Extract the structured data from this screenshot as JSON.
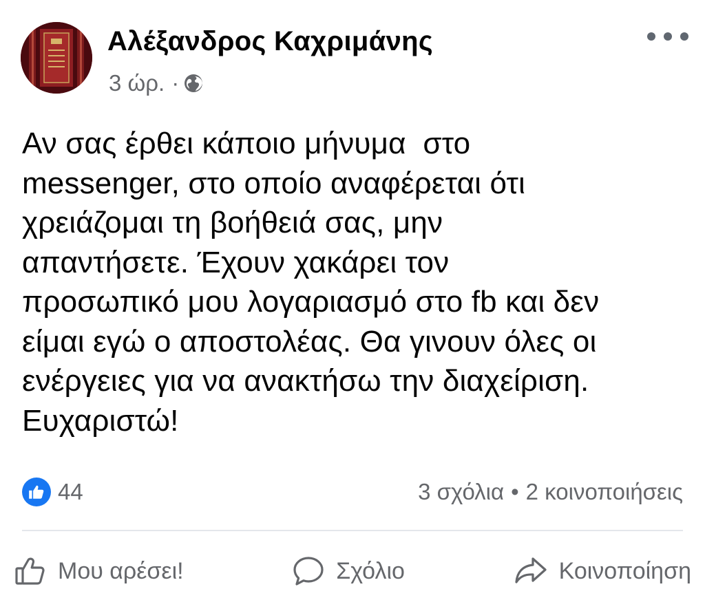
{
  "post": {
    "author": "Αλέξανδρος Καχριμάνης",
    "time": "3 ώρ.",
    "meta_separator": "·",
    "audience_icon": "globe-icon",
    "more_icon": "more-horizontal-icon",
    "text": "Αν σας έρθει κάποιο μήνυμα  στο\nmessenger, στο οποίο αναφέρεται ότι\nχρειάζομαι τη βοήθειά σας, μην\nαπαντήσετε. Έχουν χακάρει τον\nπροσωπικό μου λογαριασμό στο fb και δεν\nείμαι εγώ ο αποστολέας. Θα γινουν όλες οι\nενέργειες για να ανακτήσω την διαχείριση.\nΕυχαριστώ!"
  },
  "stats": {
    "reaction_icon": "like-reaction-icon",
    "likes_count": "44",
    "comments": "3 σχόλια",
    "separator": "•",
    "shares": "2 κοινοποιήσεις"
  },
  "actions": {
    "like_label": "Μου αρέσει!",
    "comment_label": "Σχόλιο",
    "share_label": "Κοινοποίηση"
  },
  "colors": {
    "brand_blue": "#1877f2",
    "secondary_text": "#65676b",
    "primary_text": "#050505",
    "divider": "#e4e6eb"
  }
}
